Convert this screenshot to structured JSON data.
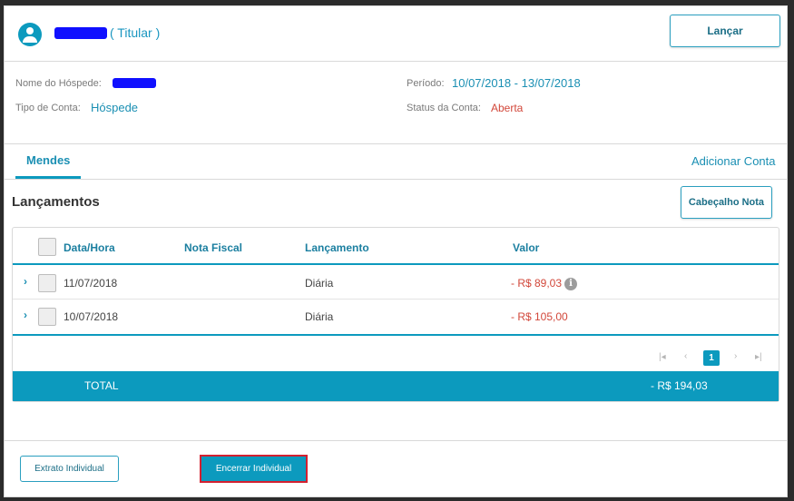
{
  "header": {
    "avatar_icon": "user-circle-icon",
    "titular_label": "( Titular )",
    "lancar_button": "Lançar"
  },
  "info": {
    "nome_label": "Nome do Hóspede:",
    "tipo_label": "Tipo de Conta:",
    "tipo_value": "Hóspede",
    "periodo_label": "Período:",
    "periodo_value": "10/07/2018 - 13/07/2018",
    "status_label": "Status da Conta:",
    "status_value": "Aberta"
  },
  "tabs": {
    "active": "Mendes",
    "adicionar": "Adicionar Conta"
  },
  "lancamentos": {
    "title": "Lançamentos",
    "cabecalho_button": "Cabeçalho Nota",
    "columns": [
      "Data/Hora",
      "Nota Fiscal",
      "Lançamento",
      "Valor"
    ],
    "rows": [
      {
        "data": "11/07/2018",
        "nota": "",
        "lancamento": "Diária",
        "valor": "- R$ 89,03",
        "info_icon": "i"
      },
      {
        "data": "10/07/2018",
        "nota": "",
        "lancamento": "Diária",
        "valor": "- R$ 105,00"
      }
    ],
    "pagination": {
      "first": "|◂",
      "prev": "‹",
      "current": "1",
      "next": "›",
      "last": "▸|"
    },
    "total_label": "TOTAL",
    "total_value": "- R$ 194,03"
  },
  "footer": {
    "extrato_button": "Extrato Individual",
    "encerrar_button": "Encerrar Individual"
  },
  "colors": {
    "accent": "#0c9abe",
    "negative": "#d2473a",
    "highlight_border": "#d32030"
  }
}
